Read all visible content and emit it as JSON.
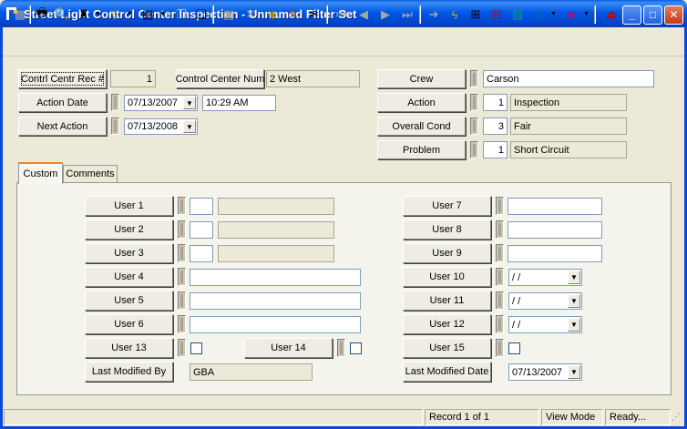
{
  "window": {
    "title": "Street Light Control Center Inspection - Unnamed Filter Set",
    "minimize": "_",
    "maximize": "□",
    "close": "✕"
  },
  "toolbar": {
    "icons": [
      "grid-icon",
      "print-icon",
      "preview-icon",
      "search-binoculars-icon",
      "filter-icon",
      "report-icon",
      "copy-disabled-icon",
      "copy-record-icon",
      "save-icon",
      "delete-icon",
      "layers-icon",
      "edit-pencil-icon",
      "cut-scissors-icon",
      "first-record-icon",
      "prev-record-icon",
      "next-record-icon",
      "last-record-icon",
      "goto-arrow-icon",
      "lightning-icon",
      "find-icon",
      "tree-icon",
      "image-icon",
      "globe-icon",
      "book-icon",
      "exit-icon"
    ]
  },
  "header": {
    "rec_label": "Contrl Centr Rec #",
    "rec_value": "1",
    "cc_num_label": "Control Center Num",
    "cc_num_value": "2 West",
    "action_date_label": "Action Date",
    "action_date_value": "07/13/2007",
    "action_time_value": "10:29 AM",
    "next_action_label": "Next Action",
    "next_action_value": "07/13/2008",
    "crew_label": "Crew",
    "crew_value": "Carson",
    "action_label": "Action",
    "action_code": "1",
    "action_value": "Inspection",
    "overall_label": "Overall Cond",
    "overall_code": "3",
    "overall_value": "Fair",
    "problem_label": "Problem",
    "problem_code": "1",
    "problem_value": "Short Circuit"
  },
  "tabs": {
    "custom": "Custom",
    "comments": "Comments"
  },
  "custom": {
    "user1": "User 1",
    "user2": "User 2",
    "user3": "User 3",
    "user4": "User 4",
    "user5": "User 5",
    "user6": "User 6",
    "user7": "User 7",
    "user8": "User 8",
    "user9": "User 9",
    "user10": "User 10",
    "user11": "User 11",
    "user12": "User 12",
    "user13": "User 13",
    "user14": "User 14",
    "user15": "User 15",
    "user10_value": " /  /",
    "user11_value": " /  /",
    "user12_value": " /  /",
    "last_modified_by_label": "Last Modified By",
    "last_modified_by_value": "GBA",
    "last_modified_date_label": "Last Modified Date",
    "last_modified_date_value": "07/13/2007"
  },
  "status": {
    "record": "Record 1 of 1",
    "mode": "View Mode",
    "state": "Ready..."
  }
}
